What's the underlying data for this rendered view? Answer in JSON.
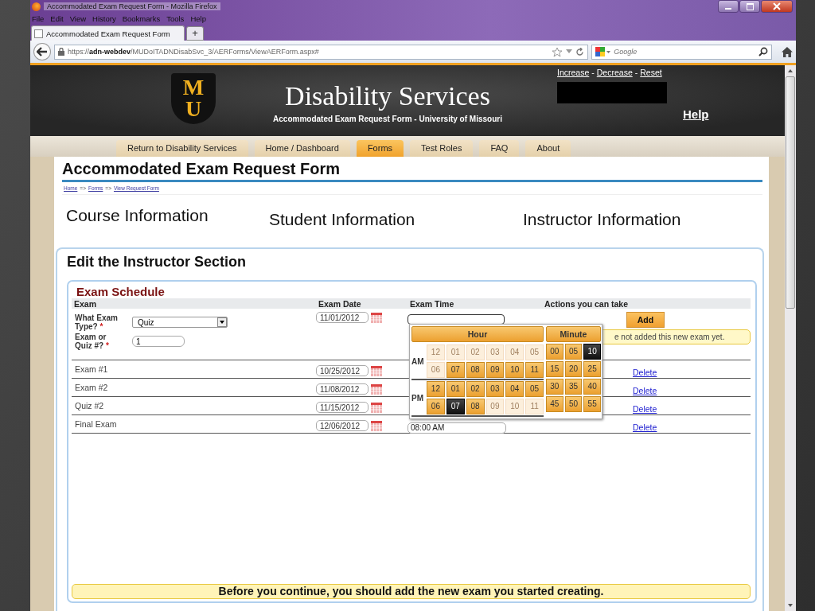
{
  "window": {
    "title": "Accommodated Exam Request Form - Mozilla Firefox"
  },
  "menu": [
    "File",
    "Edit",
    "View",
    "History",
    "Bookmarks",
    "Tools",
    "Help"
  ],
  "tab": {
    "title": "Accommodated Exam Request Form",
    "new_tab": "+"
  },
  "address_bar": {
    "scheme": "https://",
    "host": "adn-webdev",
    "path": "/MUDoITADNDisabSvc_3/AERForms/ViewAERForm.aspx#"
  },
  "search": {
    "placeholder": "Google"
  },
  "header": {
    "logo_letters": [
      "M",
      "U"
    ],
    "title": "Disability Services",
    "subtitle": "Accommodated Exam Request Form - University of Missouri",
    "text_size_links": [
      "Increase",
      "Decrease",
      "Reset"
    ],
    "link_separator": "-",
    "help": "Help"
  },
  "nav": [
    {
      "label": "Return to Disability Services",
      "selected": false
    },
    {
      "label": "Home / Dashboard",
      "selected": false
    },
    {
      "label": "Forms",
      "selected": true
    },
    {
      "label": "Test Roles",
      "selected": false
    },
    {
      "label": "FAQ",
      "selected": false
    },
    {
      "label": "About",
      "selected": false
    }
  ],
  "page_title": "Accommodated Exam Request Form",
  "breadcrumb": {
    "links": [
      "Home",
      "Forms",
      "View Request Form"
    ],
    "separator": "=>"
  },
  "sections": [
    "Course Information",
    "Student Information",
    "Instructor Information"
  ],
  "panel": {
    "title": "Edit the Instructor Section",
    "schedule": {
      "title": "Exam Schedule",
      "columns": [
        "Exam",
        "Exam Date",
        "Exam Time",
        "Actions you can take"
      ],
      "new_exam": {
        "type_label": "What Exam Type?",
        "type_value": "Quiz",
        "number_label": "Exam or Quiz #?",
        "number_value": "1",
        "required_mark": "*",
        "date": "11/01/2012",
        "add_button": "Add",
        "notice": "e not added this new exam yet."
      },
      "rows": [
        {
          "name": "Exam #1",
          "date": "10/25/2012",
          "action": "Delete"
        },
        {
          "name": "Exam #2",
          "date": "11/08/2012",
          "action": "Delete"
        },
        {
          "name": "Quiz #2",
          "date": "11/15/2012",
          "action": "Delete"
        },
        {
          "name": "Final Exam",
          "date": "12/06/2012",
          "time": "08:00 AM",
          "action": "Delete"
        }
      ]
    },
    "footer_notice": "Before you continue, you should add the new exam you started creating."
  },
  "time_picker": {
    "hour_title": "Hour",
    "minute_title": "Minute",
    "periods": [
      {
        "label": "AM",
        "hours": [
          {
            "text": "12",
            "disabled": true,
            "selected": false
          },
          {
            "text": "01",
            "disabled": true,
            "selected": false
          },
          {
            "text": "02",
            "disabled": true,
            "selected": false
          },
          {
            "text": "03",
            "disabled": true,
            "selected": false
          },
          {
            "text": "04",
            "disabled": true,
            "selected": false
          },
          {
            "text": "05",
            "disabled": true,
            "selected": false
          },
          {
            "text": "06",
            "disabled": true,
            "selected": false
          },
          {
            "text": "07",
            "disabled": false,
            "selected": false
          },
          {
            "text": "08",
            "disabled": false,
            "selected": false
          },
          {
            "text": "09",
            "disabled": false,
            "selected": false
          },
          {
            "text": "10",
            "disabled": false,
            "selected": false
          },
          {
            "text": "11",
            "disabled": false,
            "selected": false
          }
        ]
      },
      {
        "label": "PM",
        "hours": [
          {
            "text": "12",
            "disabled": false,
            "selected": false
          },
          {
            "text": "01",
            "disabled": false,
            "selected": false
          },
          {
            "text": "02",
            "disabled": false,
            "selected": false
          },
          {
            "text": "03",
            "disabled": false,
            "selected": false
          },
          {
            "text": "04",
            "disabled": false,
            "selected": false
          },
          {
            "text": "05",
            "disabled": false,
            "selected": false
          },
          {
            "text": "06",
            "disabled": false,
            "selected": false
          },
          {
            "text": "07",
            "disabled": false,
            "selected": true
          },
          {
            "text": "08",
            "disabled": false,
            "selected": false
          },
          {
            "text": "09",
            "disabled": true,
            "selected": false
          },
          {
            "text": "10",
            "disabled": true,
            "selected": false
          },
          {
            "text": "11",
            "disabled": true,
            "selected": false
          }
        ]
      }
    ],
    "minutes": [
      {
        "text": "00",
        "selected": false
      },
      {
        "text": "05",
        "selected": false
      },
      {
        "text": "10",
        "selected": true
      },
      {
        "text": "15",
        "selected": false
      },
      {
        "text": "20",
        "selected": false
      },
      {
        "text": "25",
        "selected": false
      },
      {
        "text": "30",
        "selected": false
      },
      {
        "text": "35",
        "selected": false
      },
      {
        "text": "40",
        "selected": false
      },
      {
        "text": "45",
        "selected": false
      },
      {
        "text": "50",
        "selected": false
      },
      {
        "text": "55",
        "selected": false
      }
    ]
  }
}
